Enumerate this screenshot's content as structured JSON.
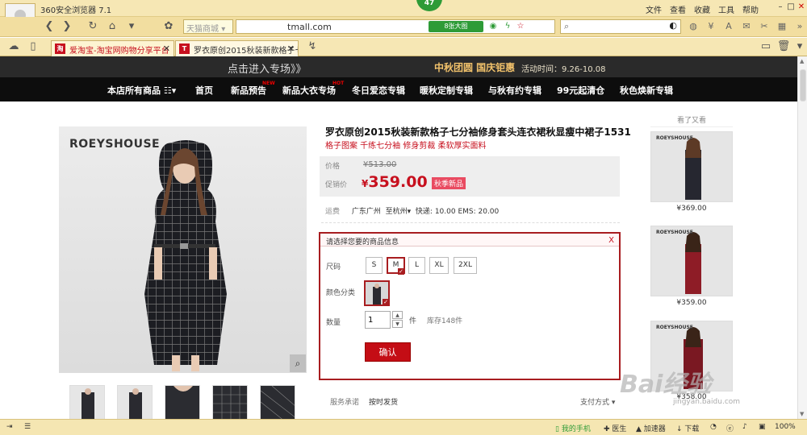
{
  "browser": {
    "app_title": "360安全浏览器 7.1",
    "badge_count": "47",
    "menu": [
      "文件",
      "查看",
      "收藏",
      "工具",
      "帮助"
    ],
    "site_select": "天猫商城",
    "url": "tmall.com",
    "url_pill": "8张大图",
    "tabs": [
      {
        "label": "爱淘宝-淘宝网购物分享平台",
        "favicon": "淘"
      },
      {
        "label": "罗衣原创2015秋装新款格子七",
        "favicon": "T"
      }
    ]
  },
  "banner": {
    "left_text": "点击进入专场》》",
    "center_text": "中秋团圆 国庆钜惠",
    "time_text": "活动时间：9.26-10.08"
  },
  "shop_nav": {
    "items": [
      "本店所有商品",
      "首页",
      "新品预告",
      "新品大衣专场",
      "冬日爱恋专辑",
      "暖秋定制专辑",
      "与秋有约专辑",
      "99元起清仓",
      "秋色焕新专辑"
    ],
    "tags": [
      "NEW",
      "HOT"
    ]
  },
  "product": {
    "brand": "ROEYSHOUSE",
    "title": "罗衣原创2015秋装新款格子七分袖修身套头连衣裙秋显瘦中裙子1531",
    "subtitle": "格子图案 千练七分袖 修身剪裁 柔软厚实面料",
    "price_label": "价格",
    "orig_price": "¥513.00",
    "sale_label": "促销价",
    "sale_currency": "¥",
    "sale_price": "359.00",
    "promo_tag": "秋季新品",
    "ship_label": "运费",
    "ship_from": "广东广州",
    "ship_to": "至杭州",
    "ship_text": "快递: 10.00 EMS: 20.00",
    "zoom_icon": "magnifier-icon"
  },
  "selection": {
    "header": "请选择您要的商品信息",
    "close": "X",
    "size_label": "尺码",
    "sizes": [
      "S",
      "M",
      "L",
      "XL",
      "2XL"
    ],
    "selected_size": "M",
    "color_label": "颜色分类",
    "qty_label": "数量",
    "qty_value": "1",
    "unit": "件",
    "stock": "库存148件",
    "confirm": "确认"
  },
  "service": {
    "label": "服务承诺",
    "value": "按时发货",
    "pay": "支付方式"
  },
  "sidebar": {
    "title": "看了又看",
    "items": [
      {
        "brand": "ROEYSHOUSE",
        "price": "¥369.00"
      },
      {
        "brand": "ROEYSHOUSE",
        "price": "¥359.00"
      },
      {
        "brand": "ROEYSHOUSE",
        "price": "¥358.00"
      }
    ]
  },
  "watermark": {
    "main": "Bai经验",
    "sub": "jingyan.baidu.com"
  },
  "status": {
    "phone": "我的手机",
    "doctor": "医生",
    "accel": "加速器",
    "download": "下载",
    "zoom": "100%"
  },
  "colors": {
    "accent": "#c7101e",
    "chrome": "#f6e7b4",
    "green": "#2e9b37"
  }
}
